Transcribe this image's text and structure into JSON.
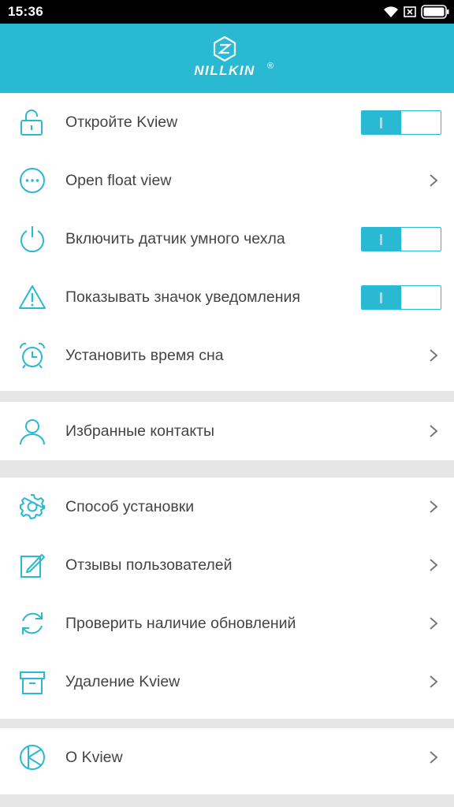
{
  "status_bar": {
    "time": "15:36"
  },
  "header": {
    "logo_text": "NILLKIN",
    "logo_mark": "®"
  },
  "accent_color": "#29b9d2",
  "sections": [
    {
      "items": [
        {
          "label": "Откройте Kview",
          "icon": "unlock-icon",
          "control": "toggle",
          "on": true
        },
        {
          "label": "Open float view",
          "icon": "ellipsis-circle-icon",
          "control": "chevron"
        },
        {
          "label": "Включить датчик умного чехла",
          "icon": "power-icon",
          "control": "toggle",
          "on": true
        },
        {
          "label": "Показывать значок уведомления",
          "icon": "warning-icon",
          "control": "toggle",
          "on": true
        },
        {
          "label": "Установить время сна",
          "icon": "alarm-clock-icon",
          "control": "chevron"
        }
      ]
    },
    {
      "items": [
        {
          "label": "Избранные контакты",
          "icon": "person-icon",
          "control": "chevron"
        }
      ]
    },
    {
      "items": [
        {
          "label": "Способ установки",
          "icon": "settings-icon",
          "control": "chevron"
        },
        {
          "label": "Отзывы пользователей",
          "icon": "edit-icon",
          "control": "chevron"
        },
        {
          "label": "Проверить наличие обновлений",
          "icon": "refresh-icon",
          "control": "chevron"
        },
        {
          "label": "Удаление Kview",
          "icon": "archive-box-icon",
          "control": "chevron"
        }
      ]
    },
    {
      "items": [
        {
          "label": "О Kview",
          "icon": "kview-logo-icon",
          "control": "chevron"
        }
      ]
    }
  ]
}
